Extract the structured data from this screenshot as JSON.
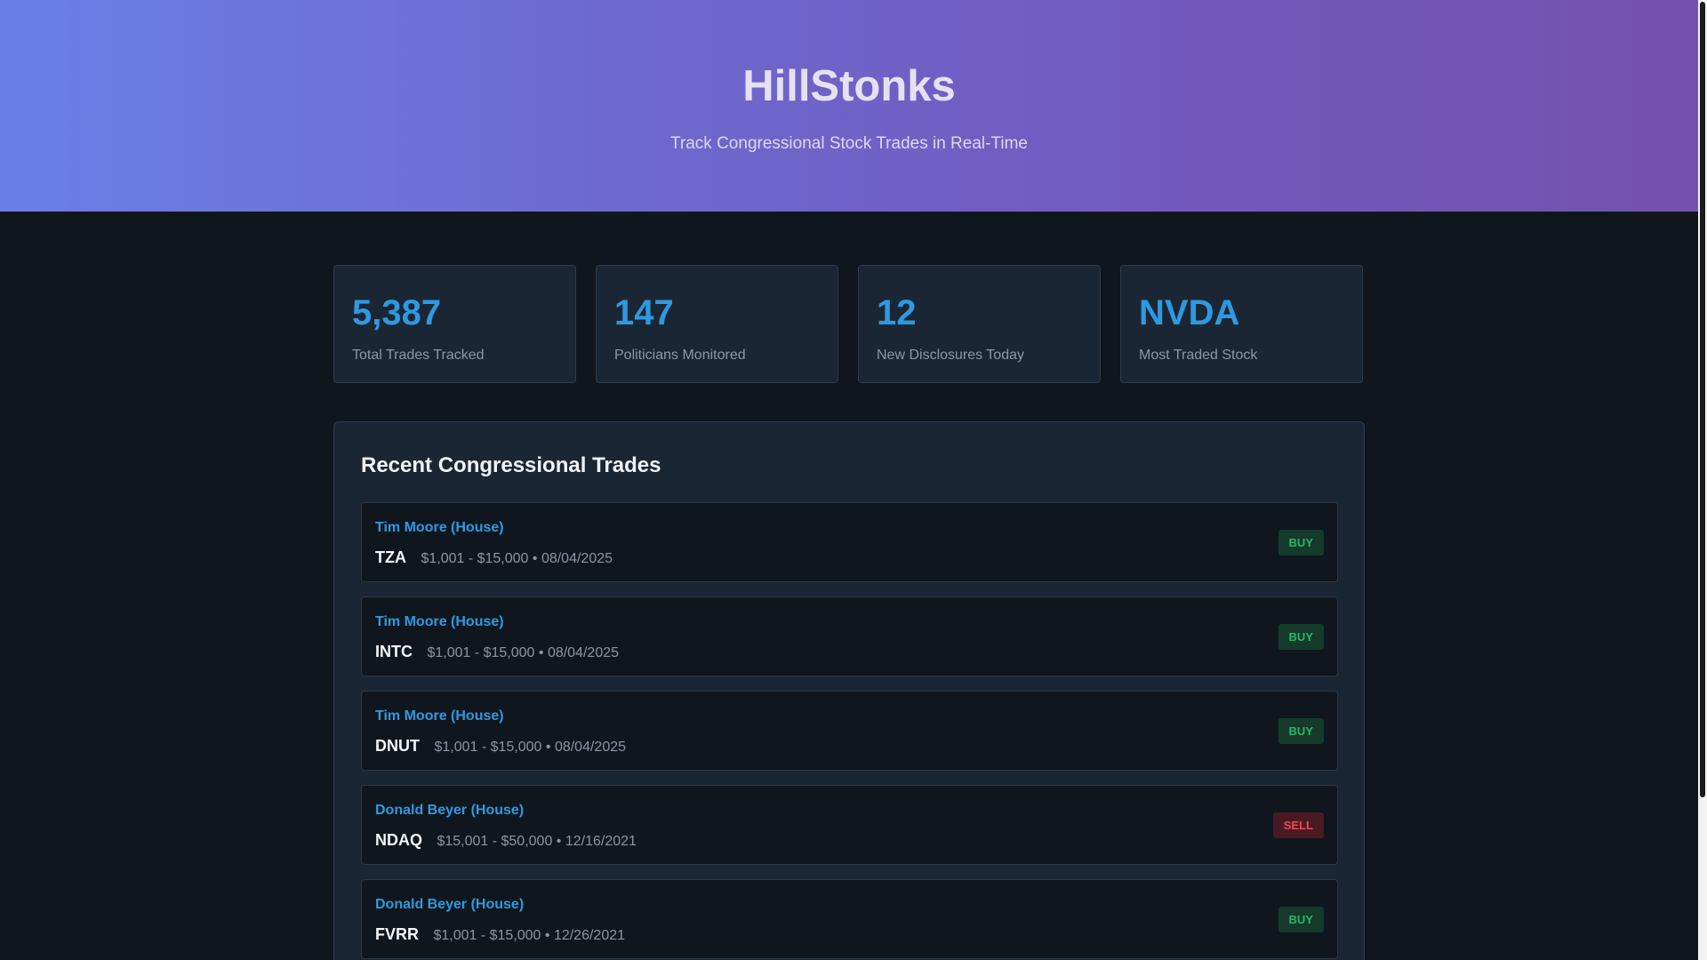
{
  "header": {
    "title": "HillStonks",
    "subtitle": "Track Congressional Stock Trades in Real-Time"
  },
  "stats": [
    {
      "value": "5,387",
      "label": "Total Trades Tracked"
    },
    {
      "value": "147",
      "label": "Politicians Monitored"
    },
    {
      "value": "12",
      "label": "New Disclosures Today"
    },
    {
      "value": "NVDA",
      "label": "Most Traded Stock"
    }
  ],
  "trades_panel": {
    "title": "Recent Congressional Trades",
    "trades": [
      {
        "politician": "Tim Moore (House)",
        "ticker": "TZA",
        "detail": "$1,001 - $15,000 • 08/04/2025",
        "type": "BUY"
      },
      {
        "politician": "Tim Moore (House)",
        "ticker": "INTC",
        "detail": "$1,001 - $15,000 • 08/04/2025",
        "type": "BUY"
      },
      {
        "politician": "Tim Moore (House)",
        "ticker": "DNUT",
        "detail": "$1,001 - $15,000 • 08/04/2025",
        "type": "BUY"
      },
      {
        "politician": "Donald Beyer (House)",
        "ticker": "NDAQ",
        "detail": "$15,001 - $50,000 • 12/16/2021",
        "type": "SELL"
      },
      {
        "politician": "Donald Beyer (House)",
        "ticker": "FVRR",
        "detail": "$1,001 - $15,000 • 12/26/2021",
        "type": "BUY"
      }
    ]
  },
  "colors": {
    "accent": "#2d9ae2",
    "buy": "#28b764",
    "sell": "#e84b57",
    "background": "#10161d",
    "card": "#1b2634"
  }
}
